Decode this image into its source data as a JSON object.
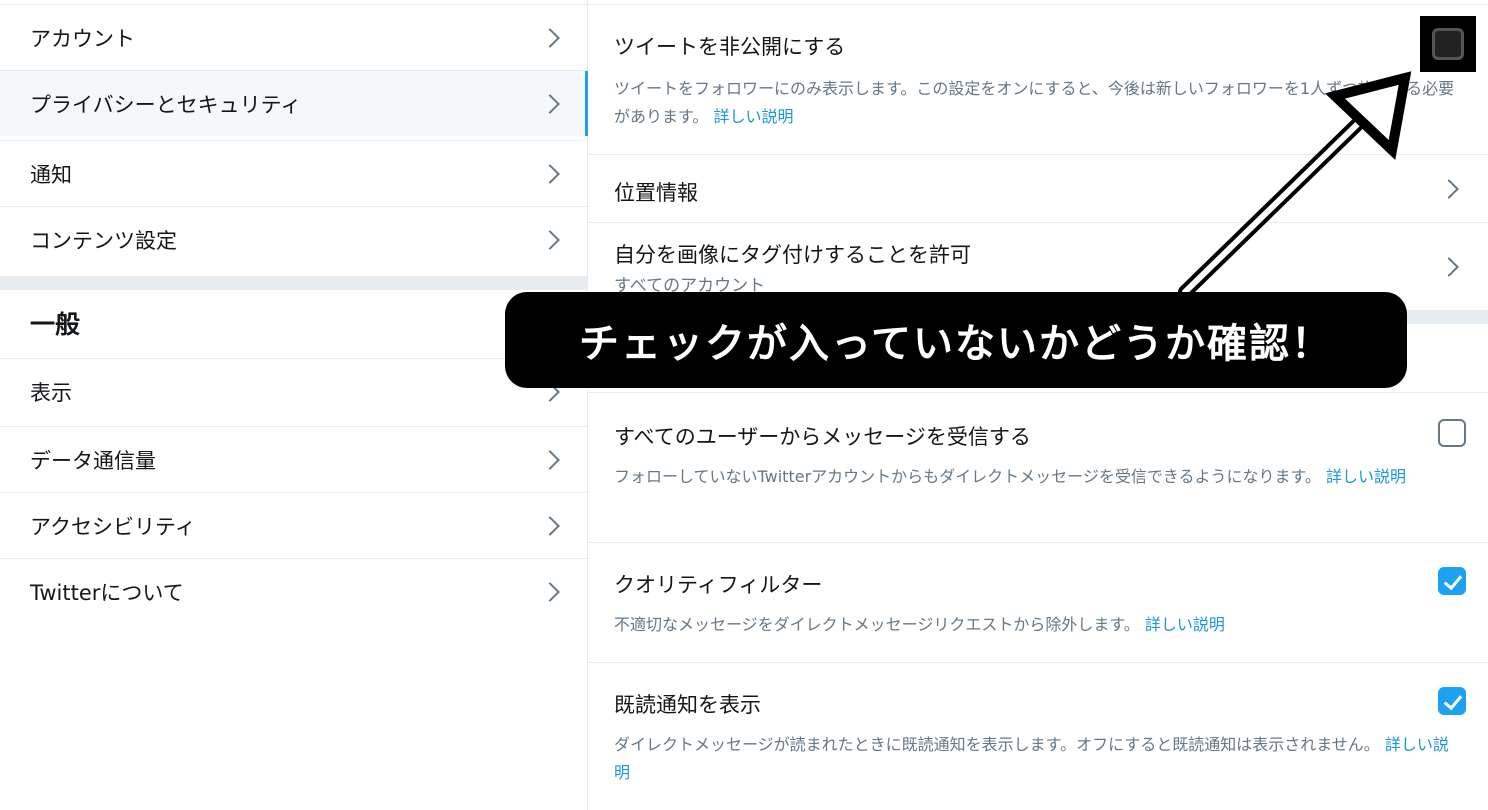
{
  "sidebar": {
    "items": [
      {
        "label": "アカウント"
      },
      {
        "label": "プライバシーとセキュリティ"
      },
      {
        "label": "通知"
      },
      {
        "label": "コンテンツ設定"
      }
    ],
    "section_title": "一般",
    "general_items": [
      {
        "label": "表示"
      },
      {
        "label": "データ通信量"
      },
      {
        "label": "アクセシビリティ"
      },
      {
        "label": "Twitterについて"
      }
    ]
  },
  "main": {
    "protect_tweets": {
      "title": "ツイートを非公開にする",
      "desc": "ツイートをフォロワーにのみ表示します。この設定をオンにすると、今後は新しいフォロワーを1人ずつ許可する必要があります。",
      "link": "詳しい説明",
      "checked": false
    },
    "location": {
      "title": "位置情報"
    },
    "photo_tagging": {
      "title": "自分を画像にタグ付けすることを許可",
      "sub": "すべてのアカウント"
    },
    "dm_all": {
      "title": "すべてのユーザーからメッセージを受信する",
      "desc": "フォローしていないTwitterアカウントからもダイレクトメッセージを受信できるようになります。",
      "link": "詳しい説明",
      "checked": false
    },
    "quality_filter": {
      "title": "クオリティフィルター",
      "desc": "不適切なメッセージをダイレクトメッセージリクエストから除外します。",
      "link": "詳しい説明",
      "checked": true
    },
    "read_receipts": {
      "title": "既読通知を表示",
      "desc": "ダイレクトメッセージが読まれたときに既読通知を表示します。オフにすると既読通知は表示されません。",
      "link": "詳しい説明",
      "checked": true
    }
  },
  "annotation": {
    "text": "チェックが入っていないかどうか確認！"
  }
}
